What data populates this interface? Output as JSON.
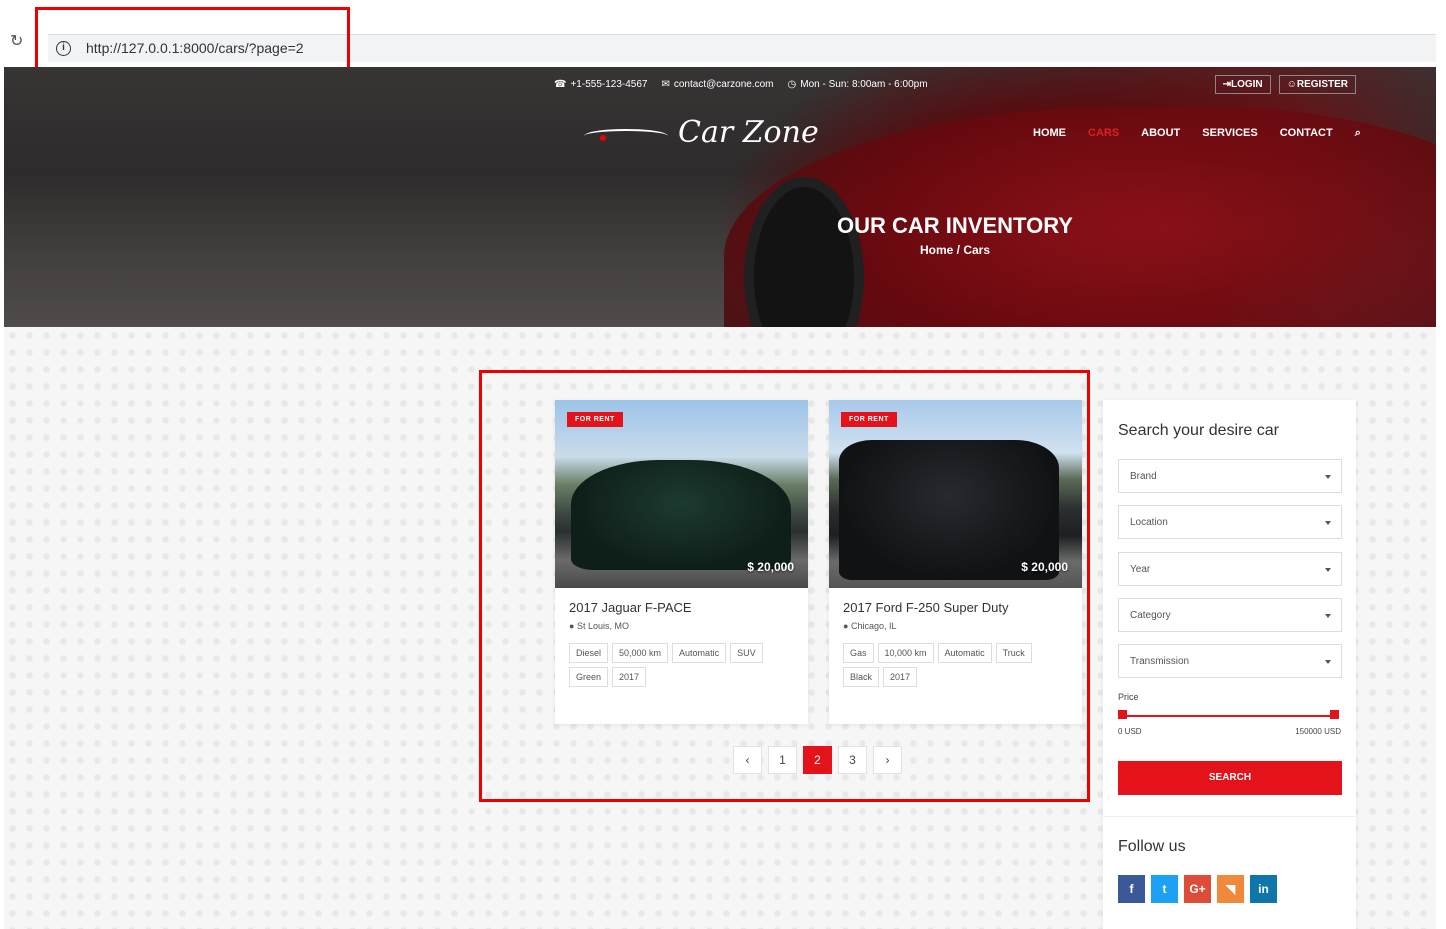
{
  "browser": {
    "url": "http://127.0.0.1:8000/cars/?page=2"
  },
  "topbar": {
    "phone": "+1-555-123-4567",
    "email": "contact@carzone.com",
    "hours": "Mon - Sun: 8:00am - 6:00pm",
    "login": "LOGIN",
    "register": "REGISTER"
  },
  "logo": {
    "text": "Car Zone"
  },
  "nav": [
    "HOME",
    "CARS",
    "ABOUT",
    "SERVICES",
    "CONTACT"
  ],
  "hero": {
    "title": "OUR CAR INVENTORY",
    "breadcrumb": "Home  /  Cars"
  },
  "cars": [
    {
      "badge": "FOR RENT",
      "price": "$ 20,000",
      "title": "2017 Jaguar F-PACE",
      "location": "St Louis, MO",
      "tags": [
        "Diesel",
        "50,000 km",
        "Automatic",
        "SUV",
        "Green",
        "2017"
      ]
    },
    {
      "badge": "FOR RENT",
      "price": "$ 20,000",
      "title": "2017 Ford F-250 Super Duty",
      "location": "Chicago, IL",
      "tags": [
        "Gas",
        "10,000 km",
        "Automatic",
        "Truck",
        "Black",
        "2017"
      ]
    }
  ],
  "pagination": {
    "prev": "‹",
    "pages": [
      "1",
      "2",
      "3"
    ],
    "current": "2",
    "next": "›"
  },
  "search": {
    "title": "Search your desire car",
    "fields": [
      "Brand",
      "Location",
      "Year",
      "Category",
      "Transmission"
    ],
    "price_label": "Price",
    "min": "0 USD",
    "max": "150000 USD",
    "button": "SEARCH"
  },
  "follow": {
    "title": "Follow us",
    "icons": [
      "f",
      "t",
      "G+",
      "rss",
      "in"
    ]
  },
  "colors": {
    "accent": "#e4121b",
    "facebook": "#3b5998",
    "twitter": "#1da1f2",
    "google": "#dd4b39",
    "rss": "#f0893a",
    "linkedin": "#0e76a8"
  }
}
